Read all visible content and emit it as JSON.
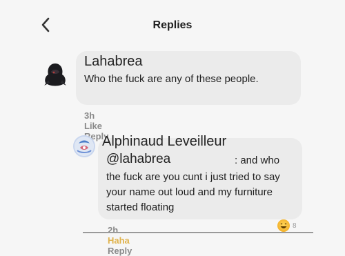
{
  "header": {
    "title": "Replies"
  },
  "comments": [
    {
      "author": "Lahabrea",
      "text": "Who the fuck are any of these people.",
      "time": "3h",
      "like": "Like",
      "reply": "Reply"
    },
    {
      "author": "Alphinaud Leveilleur",
      "mention": "@lahabrea",
      "text_after_mention": ": and who",
      "text": "the fuck are you cunt i just tried to say your name out loud and my furniture started floating",
      "time": "2h",
      "reaction_label": "Haha",
      "reply": "Reply",
      "reaction_count": "8"
    }
  ],
  "icons": {
    "back": "chevron-left-icon",
    "avatar1": "dark-hooded-figure-avatar",
    "avatar2": "crystal-orb-avatar",
    "reaction": "laugh-emoji-icon"
  }
}
